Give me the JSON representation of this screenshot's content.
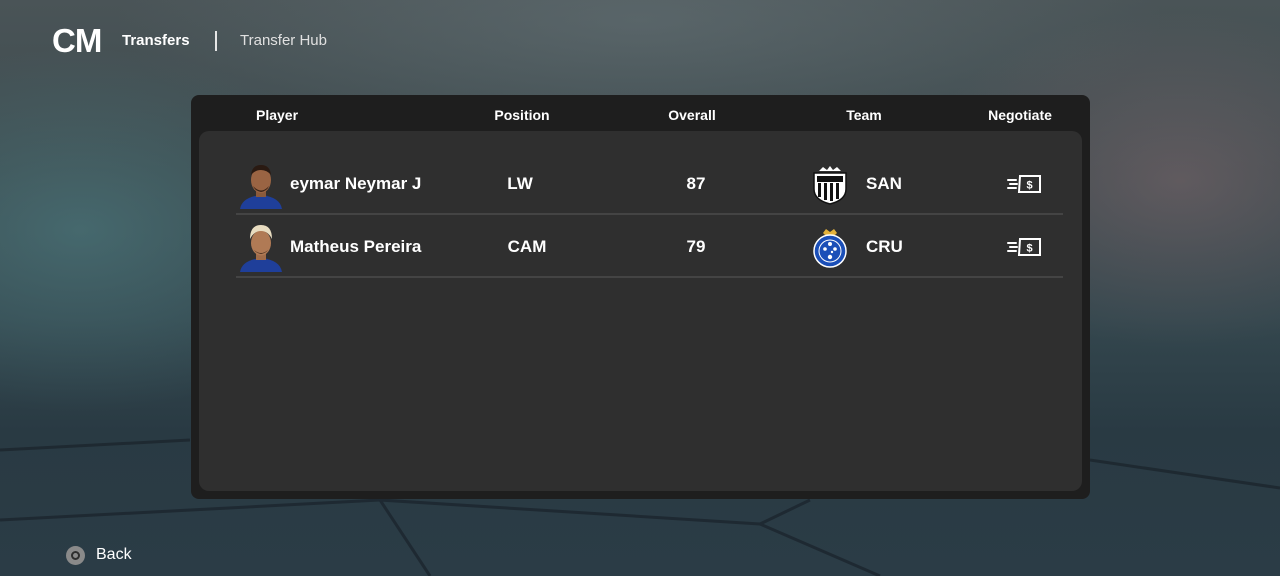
{
  "header": {
    "logo": "CM",
    "section": "Transfers",
    "subsection": "Transfer Hub"
  },
  "table": {
    "columns": [
      "Player",
      "Position",
      "Overall",
      "Team",
      "Negotiate"
    ],
    "rows": [
      {
        "player": "eymar Neymar J",
        "position": "LW",
        "overall": "87",
        "team": "SAN",
        "crest_icon": "santos-crest-icon"
      },
      {
        "player": "Matheus Pereira",
        "position": "CAM",
        "overall": "79",
        "team": "CRU",
        "crest_icon": "cruzeiro-crest-icon"
      }
    ]
  },
  "footer": {
    "back_label": "Back"
  },
  "colors": {
    "panel_outer": "#1e1e1e",
    "panel_inner": "#2f2f2f",
    "divider": "#444444",
    "text": "#ffffff"
  }
}
